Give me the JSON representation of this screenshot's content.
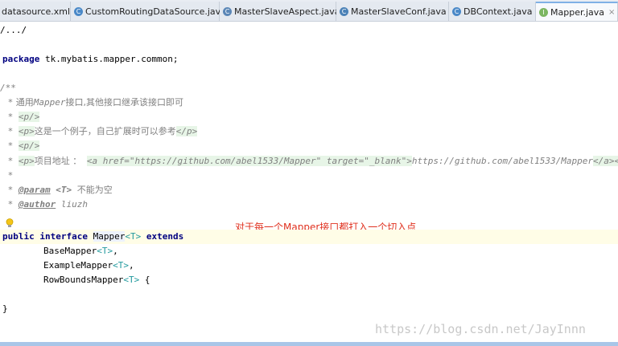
{
  "tabs": [
    {
      "label": "datasource.xml",
      "icon": "xml-file-icon",
      "active": false
    },
    {
      "label": "CustomRoutingDataSource.java",
      "icon": "java-class-icon",
      "active": false
    },
    {
      "label": "MasterSlaveAspect.java",
      "icon": "java-class-icon",
      "active": false
    },
    {
      "label": "MasterSlaveConf.java",
      "icon": "java-class-icon",
      "active": false
    },
    {
      "label": "DBContext.java",
      "icon": "java-class-icon",
      "active": false
    },
    {
      "label": "Mapper.java",
      "icon": "java-interface-icon",
      "active": true
    }
  ],
  "tab_close_symbol": "×",
  "code": {
    "fold": "/.../",
    "package_kw": "package",
    "package_name": " tk.mybatis.mapper.common;",
    "doc_open": "/**",
    "doc_star": " *",
    "doc_line1_pre": " 通用",
    "doc_line1_mapper": "Mapper",
    "doc_line1_post": "接口,其他接口继承该接口即可",
    "p_self": "<p/>",
    "p_open": "<p>",
    "p_close": "</p>",
    "doc_line3_text": "这是一个例子，自己扩展时可以参考",
    "doc_line6_text": "项目地址 ：",
    "a_open": "<a href=\"https://github.com/abel1533/Mapper\" target=\"_blank\">",
    "url_text": "https://github.com/abel1533/Mapper",
    "a_close": "</a>",
    "param_tag": "@param",
    "param_type": "<T>",
    "param_desc": "不能为空",
    "author_tag": "@author",
    "author_name": "liuzh",
    "public_kw": "public",
    "interface_kw": "interface",
    "iface_name": "Mapper",
    "type_param": "<T>",
    "extends_kw": "extends",
    "base_mapper": "BaseMapper",
    "example_mapper": "ExampleMapper",
    "rowbounds_mapper": "RowBoundsMapper",
    "comma": ",",
    "open_brace": " {",
    "close_brace": "}"
  },
  "annotation_note": "对于每一个Mapper接口都打入一个切入点",
  "watermark": "https://blog.csdn.net/JayInnn",
  "colors": {
    "keyword": "#000080",
    "comment": "#808080",
    "type_param": "#20999d",
    "note_red": "#e0301e",
    "caret_line": "#fffde7"
  }
}
